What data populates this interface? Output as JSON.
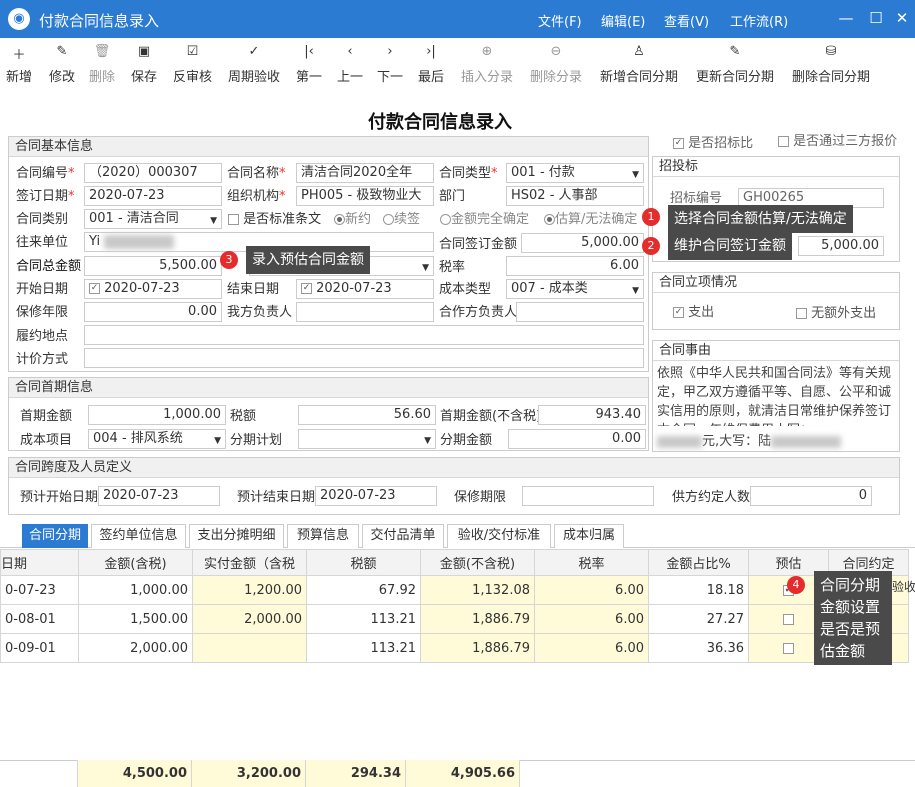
{
  "window": {
    "title": "付款合同信息录入",
    "menus": [
      "文件(F)",
      "编辑(E)",
      "查看(V)",
      "工作流(R)"
    ]
  },
  "toolbar": {
    "buttons": [
      "新增",
      "修改",
      "删除",
      "保存",
      "反审核",
      "周期验收",
      "第一",
      "上一",
      "下一",
      "最后",
      "插入分录",
      "删除分录",
      "新增合同分期",
      "更新合同分期",
      "删除合同分期"
    ]
  },
  "page_title": "付款合同信息录入",
  "basic": {
    "header": "合同基本信息",
    "contract_no_label": "合同编号",
    "contract_no": "（2020）000307",
    "contract_name_label": "合同名称",
    "contract_name": "清洁合同2020全年",
    "contract_type_label": "合同类型",
    "contract_type": "001 - 付款",
    "sign_date_label": "签订日期",
    "sign_date": "2020-07-23",
    "org_label": "组织机构",
    "org": "PH005 - 极致物业大",
    "dept_label": "部门",
    "dept": "HS02 - 人事部",
    "category_label": "合同类别",
    "category": "001 - 清洁合同",
    "std_clause_label": "是否标准条文",
    "new_label": "新约",
    "renew_label": "续签",
    "amount_fixed_label": "金额完全确定",
    "amount_est_label": "估算/无法确定",
    "partner_label": "往来单位",
    "partner": "Yi",
    "sign_amount_label": "合同签订金额",
    "sign_amount": "5,000.00",
    "total_amount_label": "合同总金额",
    "total_amount": "5,500.00",
    "tax_label": "税率",
    "tax_rate": "6.00",
    "start_label": "开始日期",
    "start_date": "2020-07-23",
    "end_label": "结束日期",
    "end_date": "2020-07-23",
    "cost_type_label": "成本类型",
    "cost_type": "007 - 成本类",
    "warranty_label": "保修年限",
    "warranty": "0.00",
    "our_person_label": "我方负责人",
    "partner_person_label": "合作方负责人",
    "place_label": "履约地点",
    "pricing_label": "计价方式"
  },
  "right": {
    "bid_check_label": "是否招标比",
    "third_party_label": "是否通过三方报价",
    "bid_header": "招投标",
    "bid_no_label": "招标编号",
    "bid_no": "GH00265",
    "bid_amount": "5,000.00",
    "project_header": "合同立项情况",
    "expense_label": "支出",
    "no_budget_label": "无额外支出",
    "matter_header": "合同事由",
    "matter_text": "依照《中华人民共和国合同法》等有关规定，甲乙双方遵循平等、自愿、公平和诚实信用的原则，就清洁日常维护保养签订本合同。年维保费用小写：",
    "matter_tail": "元,大写：陆"
  },
  "first": {
    "header": "合同首期信息",
    "amount_label": "首期金额",
    "amount": "1,000.00",
    "tax_label": "税额",
    "tax": "56.60",
    "notax_label": "首期金额(不含税)",
    "notax": "943.40",
    "cost_item_label": "成本项目",
    "cost_item": "004 - 排风系统",
    "plan_label": "分期计划",
    "inst_amount_label": "分期金额",
    "inst_amount": "0.00"
  },
  "span": {
    "header": "合同跨度及人员定义",
    "pstart_label": "预计开始日期",
    "pstart": "2020-07-23",
    "pend_label": "预计结束日期",
    "pend": "2020-07-23",
    "warranty_label": "保修期限",
    "supplier_label": "供方约定人数",
    "supplier": "0"
  },
  "tabs": [
    "合同分期",
    "签约单位信息",
    "支出分摊明细",
    "预算信息",
    "交付品清单",
    "验收/交付标准",
    "成本归属"
  ],
  "grid": {
    "columns": [
      "日期",
      "金额(含税)",
      "实付金额（含税",
      "税额",
      "金额(不含税)",
      "税率",
      "金额占比%",
      "预估",
      "合同约定"
    ],
    "rows": [
      [
        "0-07-23",
        "1,000.00",
        "1,200.00",
        "67.92",
        "1,132.08",
        "6.00",
        "18.18",
        "✔",
        ""
      ],
      [
        "0-08-01",
        "1,500.00",
        "2,000.00",
        "113.21",
        "1,886.79",
        "6.00",
        "27.27",
        "",
        ""
      ],
      [
        "0-09-01",
        "2,000.00",
        "",
        "113.21",
        "1,886.79",
        "6.00",
        "36.36",
        "",
        ""
      ]
    ],
    "totals": [
      "4,500.00",
      "3,200.00",
      "294.34",
      "4,905.66"
    ],
    "edge_text": "验收"
  },
  "callouts": [
    {
      "n": "1",
      "text": "选择合同金额估算/无法确定"
    },
    {
      "n": "2",
      "text": "维护合同签订金额"
    },
    {
      "n": "3",
      "text": "录入预估合同金额"
    },
    {
      "n": "4",
      "text": "合同分期金额设置是否是预估金额"
    }
  ]
}
